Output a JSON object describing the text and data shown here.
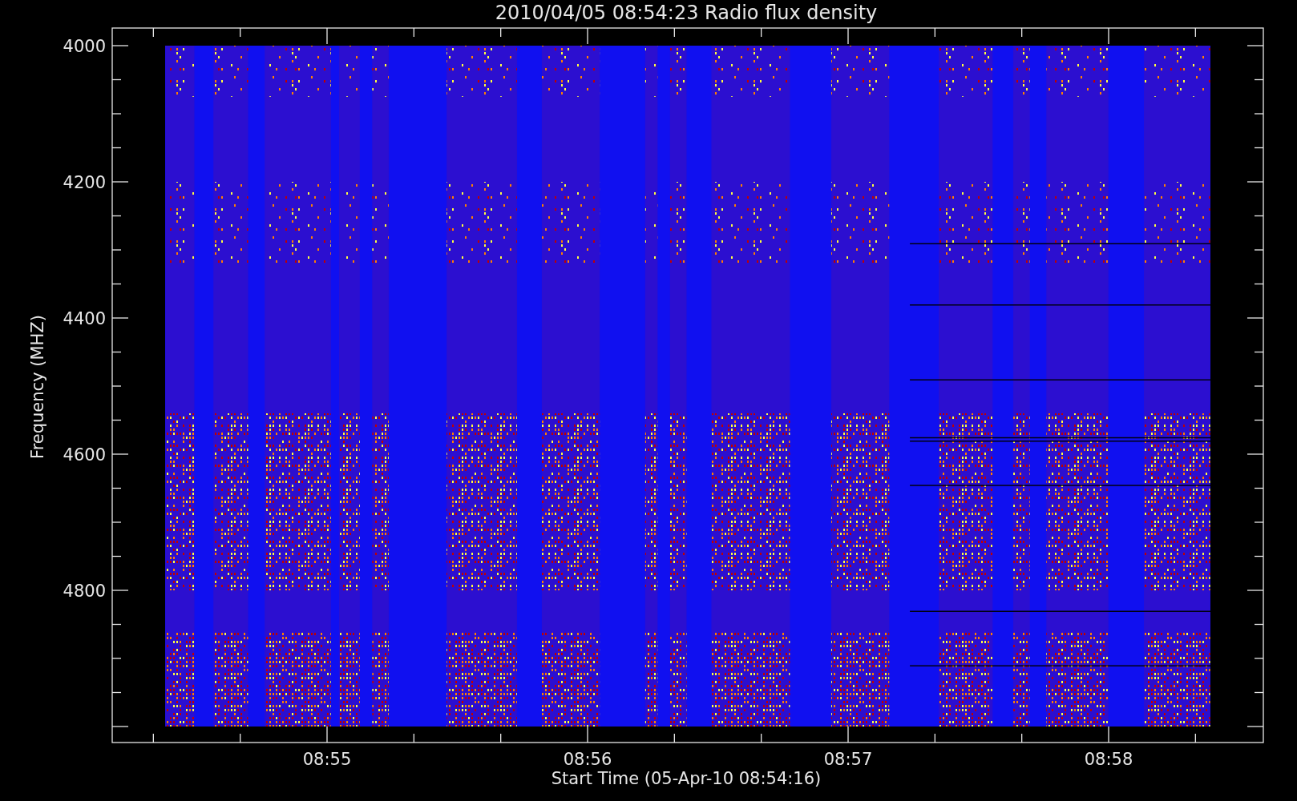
{
  "title": "2010/04/05 08:54:23 Radio flux density",
  "y_axis": {
    "label": "Frequency (MHZ)",
    "ticks": [
      "4000",
      "4200",
      "4400",
      "4600",
      "4800"
    ]
  },
  "x_axis": {
    "label": "Start Time (05-Apr-10 08:54:16)",
    "ticks": [
      "08:55",
      "08:56",
      "08:57",
      "08:58"
    ]
  }
}
